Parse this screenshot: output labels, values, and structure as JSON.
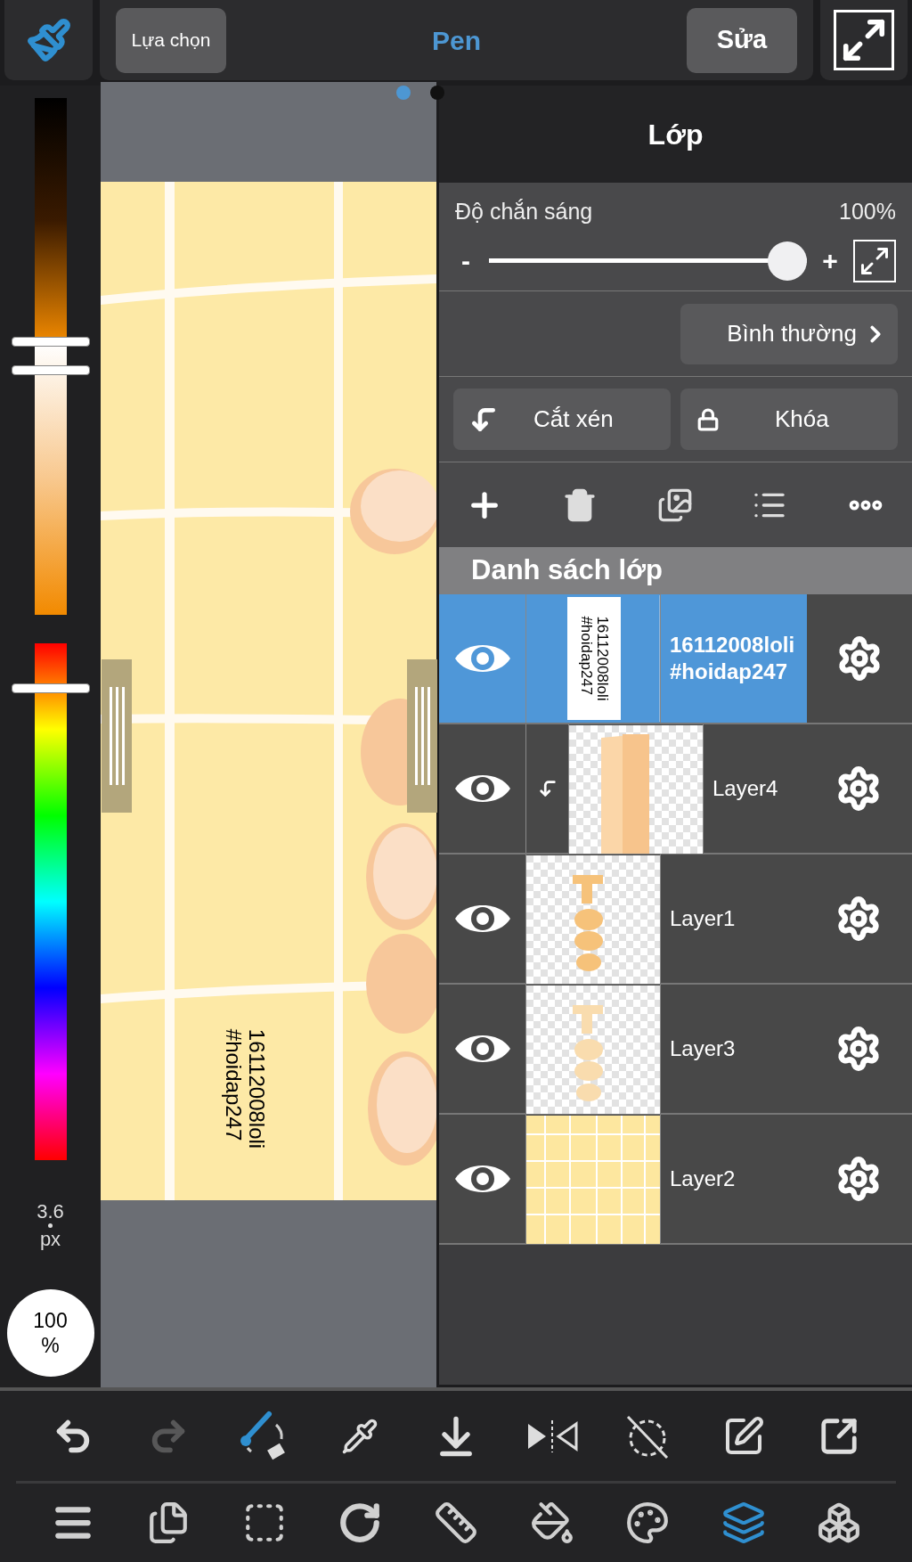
{
  "top_bar": {
    "select_button": "Lựa chọn",
    "tool_name": "Pen",
    "edit_button": "Sửa"
  },
  "page_dots": [
    {
      "selected": true
    },
    {
      "selected": false
    }
  ],
  "brush": {
    "size": "3.6",
    "unit": "px",
    "opacity": "100",
    "opacity_unit": "%"
  },
  "canvas_text": [
    "16112008loli",
    "#hoidap247"
  ],
  "layer_panel": {
    "title": "Lớp",
    "opacity_label": "Độ chắn sáng",
    "opacity_value": "100%",
    "minus": "-",
    "plus": "+",
    "level": 1,
    "blend_mode": "Bình thường",
    "clip_button": "Cắt xén",
    "lock_button": "Khóa",
    "list_title": "Danh sách lớp"
  },
  "layers": [
    {
      "name": "16112008loli\n#hoidap247",
      "visible": true,
      "selected": true,
      "clipped": false,
      "thumbnail": {
        "kind": "text"
      },
      "thumbnail_text": [
        "16112008loli",
        "#hoidap247"
      ]
    },
    {
      "name": "Layer4",
      "visible": true,
      "selected": false,
      "clipped": true,
      "thumbnail": {
        "kind": "bar"
      }
    },
    {
      "name": "Layer1",
      "visible": true,
      "selected": false,
      "clipped": false,
      "thumbnail": {
        "kind": "script"
      }
    },
    {
      "name": "Layer3",
      "visible": true,
      "selected": false,
      "clipped": false,
      "thumbnail": {
        "kind": "script-faint"
      }
    },
    {
      "name": "Layer2",
      "visible": true,
      "selected": false,
      "clipped": false,
      "thumbnail": {
        "kind": "grid"
      }
    }
  ],
  "action_tools": [
    {
      "kind": "undo",
      "disabled": false
    },
    {
      "kind": "redo",
      "disabled": true
    },
    {
      "kind": "swap"
    },
    {
      "kind": "eyedropper",
      "disabled": false
    },
    {
      "kind": "save",
      "disabled": false
    },
    {
      "kind": "flip"
    },
    {
      "kind": "rotate-off"
    },
    {
      "kind": "erase-area",
      "disabled": false
    },
    {
      "kind": "share",
      "disabled": false
    }
  ],
  "main_tools": [
    {
      "kind": "menu",
      "selected": false
    },
    {
      "kind": "pages",
      "selected": false
    },
    {
      "kind": "selection",
      "selected": false
    },
    {
      "kind": "rotate",
      "selected": false
    },
    {
      "kind": "ruler",
      "selected": false
    },
    {
      "kind": "fill",
      "selected": false
    },
    {
      "kind": "palette",
      "selected": false
    },
    {
      "kind": "layers",
      "selected": true
    },
    {
      "kind": "materials",
      "selected": false
    }
  ]
}
